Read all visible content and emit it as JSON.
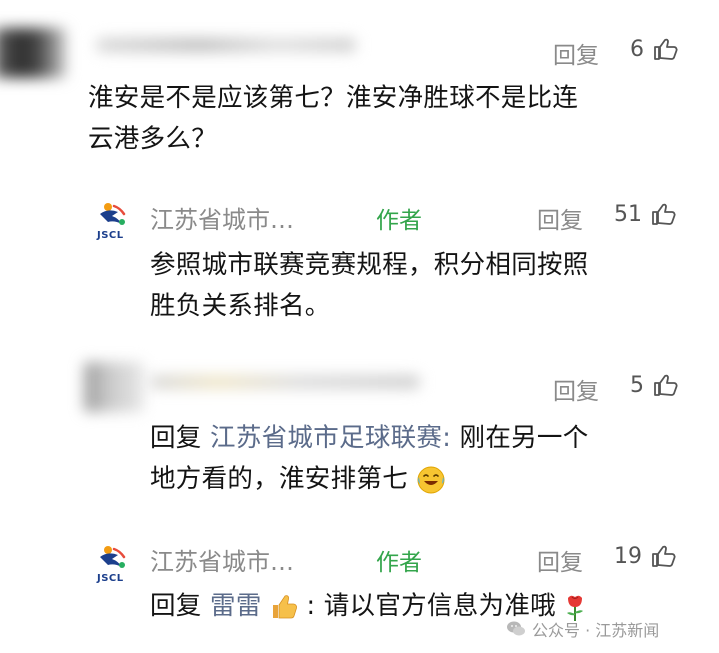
{
  "comments": [
    {
      "reply_label": "回复",
      "likes": "6",
      "text_line1": "淮安是不是应该第七？淮安净胜球不是比连",
      "text_line2": "云港多么？"
    },
    {
      "author": "江苏省城市…",
      "author_badge": "作者",
      "logo_text": "JSCL",
      "reply_label": "回复",
      "likes": "51",
      "text_line1": "参照城市联赛竞赛规程，积分相同按照",
      "text_line2": "胜负关系排名。"
    },
    {
      "reply_label": "回复",
      "likes": "5",
      "prefix": "回复",
      "mention": "江苏省城市足球联赛:",
      "text_line1_rest": "刚在另一个",
      "text_line2": "地方看的，淮安排第七",
      "emoji": "laugh-cry"
    },
    {
      "author": "江苏省城市…",
      "author_badge": "作者",
      "logo_text": "JSCL",
      "reply_label": "回复",
      "likes": "19",
      "prefix": "回复",
      "mention": "雷雷",
      "mention_emoji": "thumbs-up",
      "text_rest": ": 请以官方信息为准哦",
      "end_emoji": "rose"
    }
  ],
  "watermark": "公众号 · 江苏新闻",
  "colors": {
    "author_badge": "#33a54b",
    "grey_text": "#8a8a8a",
    "logo_blue": "#1c3f8c",
    "logo_orange": "#f39c12"
  }
}
